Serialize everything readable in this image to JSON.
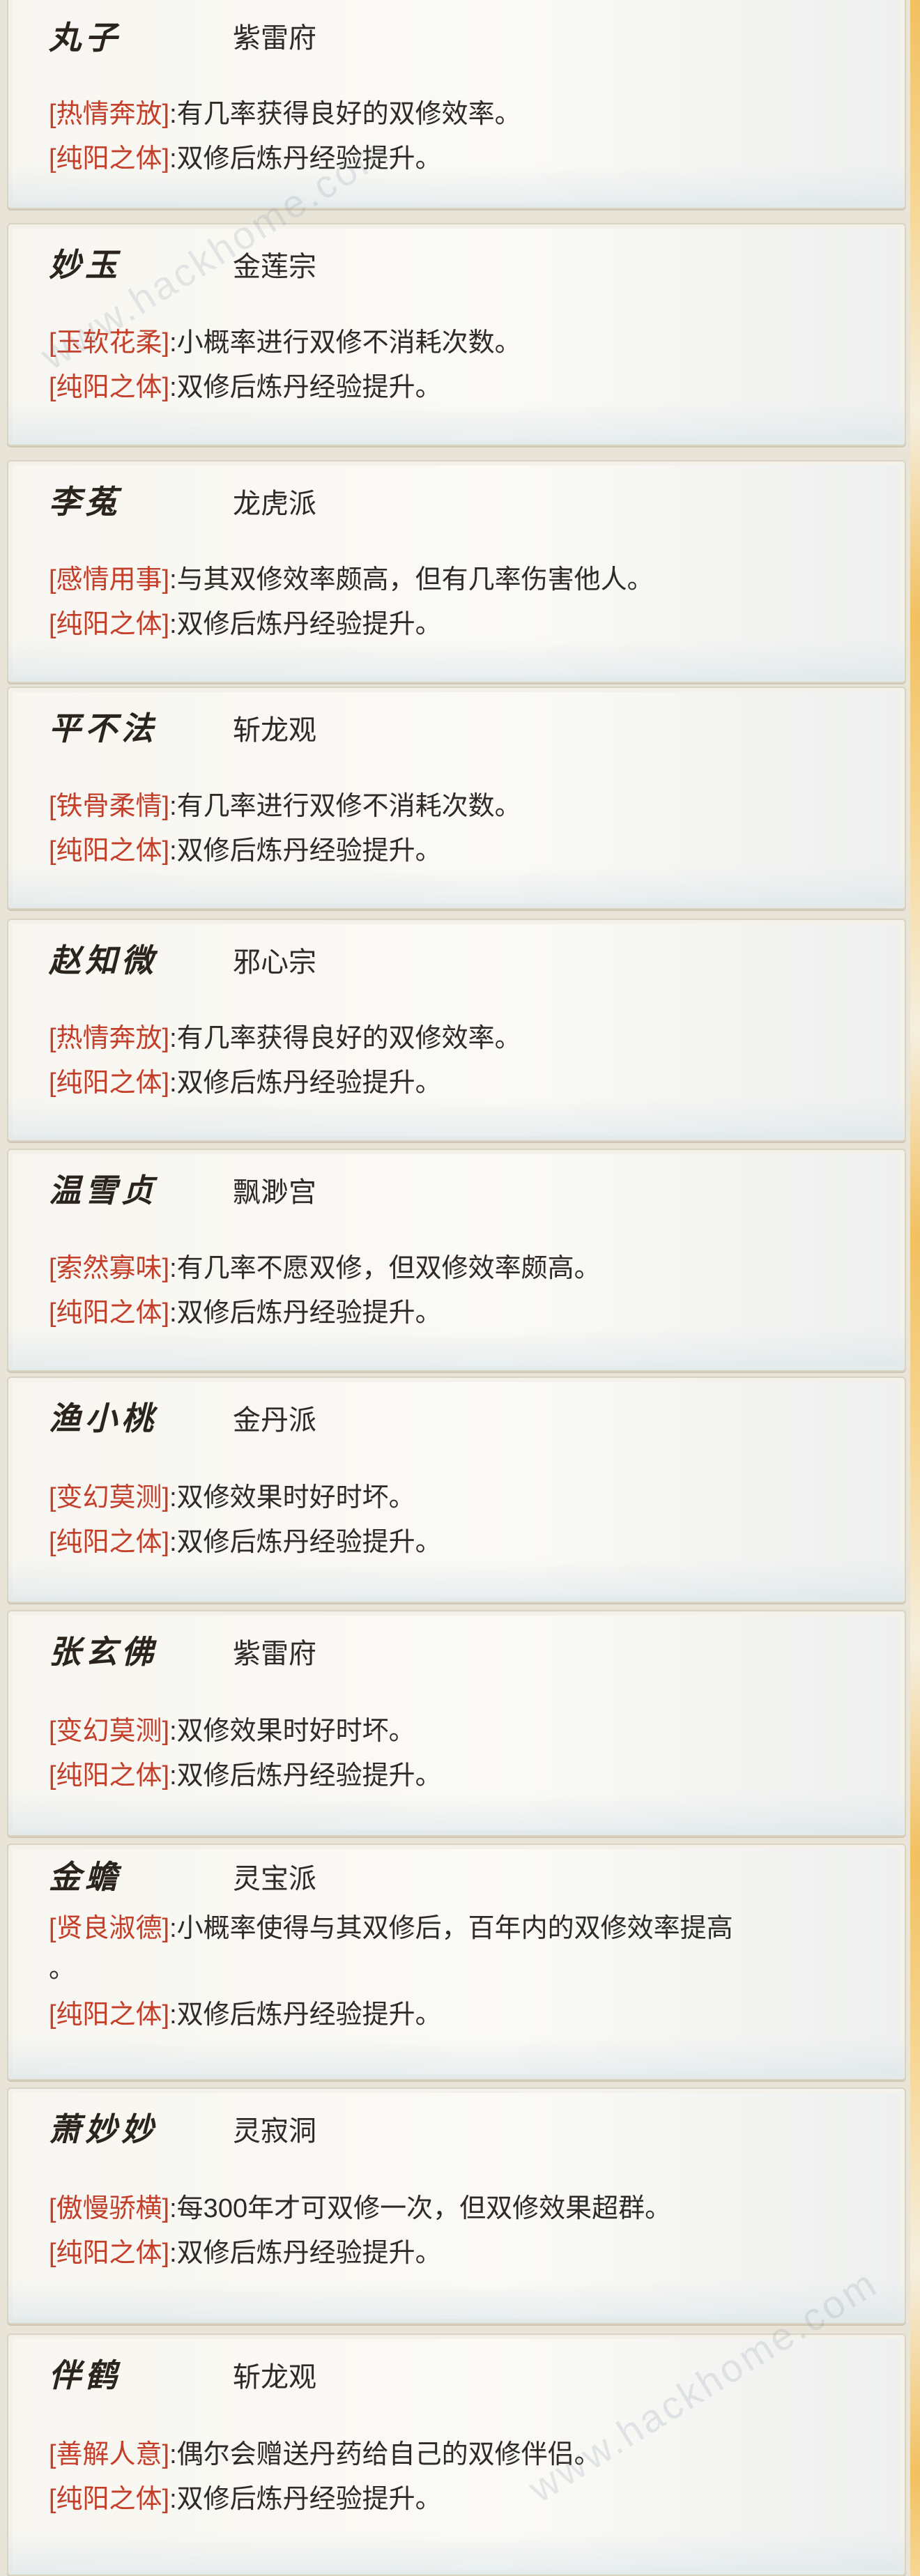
{
  "cards": [
    {
      "name": "丸子",
      "sect": "紫雷府",
      "traits": [
        {
          "tag": "[热情奔放]",
          "desc": ":有几率获得良好的双修效率。"
        },
        {
          "tag": "[纯阳之体]",
          "desc": ":双修后炼丹经验提升。"
        }
      ]
    },
    {
      "name": "妙玉",
      "sect": "金莲宗",
      "traits": [
        {
          "tag": "[玉软花柔]",
          "desc": ":小概率进行双修不消耗次数。"
        },
        {
          "tag": "[纯阳之体]",
          "desc": ":双修后炼丹经验提升。"
        }
      ]
    },
    {
      "name": "李菟",
      "sect": "龙虎派",
      "traits": [
        {
          "tag": "[感情用事]",
          "desc": ":与其双修效率颇高，但有几率伤害他人。"
        },
        {
          "tag": "[纯阳之体]",
          "desc": ":双修后炼丹经验提升。"
        }
      ]
    },
    {
      "name": "平不法",
      "sect": "斩龙观",
      "traits": [
        {
          "tag": "[铁骨柔情]",
          "desc": ":有几率进行双修不消耗次数。"
        },
        {
          "tag": "[纯阳之体]",
          "desc": ":双修后炼丹经验提升。"
        }
      ]
    },
    {
      "name": "赵知微",
      "sect": "邪心宗",
      "traits": [
        {
          "tag": "[热情奔放]",
          "desc": ":有几率获得良好的双修效率。"
        },
        {
          "tag": "[纯阳之体]",
          "desc": ":双修后炼丹经验提升。"
        }
      ]
    },
    {
      "name": "温雪贞",
      "sect": "飘渺宫",
      "traits": [
        {
          "tag": "[索然寡味]",
          "desc": ":有几率不愿双修，但双修效率颇高。"
        },
        {
          "tag": "[纯阳之体]",
          "desc": ":双修后炼丹经验提升。"
        }
      ]
    },
    {
      "name": "渔小桃",
      "sect": "金丹派",
      "traits": [
        {
          "tag": "[变幻莫测]",
          "desc": ":双修效果时好时坏。"
        },
        {
          "tag": "[纯阳之体]",
          "desc": ":双修后炼丹经验提升。"
        }
      ]
    },
    {
      "name": "张玄佛",
      "sect": "紫雷府",
      "traits": [
        {
          "tag": "[变幻莫测]",
          "desc": ":双修效果时好时坏。"
        },
        {
          "tag": "[纯阳之体]",
          "desc": ":双修后炼丹经验提升。"
        }
      ]
    },
    {
      "name": "金蟾",
      "sect": "灵宝派",
      "traits": [
        {
          "tag": "[贤良淑德]",
          "desc": ":小概率使得与其双修后，百年内的双修效率提高"
        },
        {
          "tag": "",
          "desc": "。"
        },
        {
          "tag": "[纯阳之体]",
          "desc": ":双修后炼丹经验提升。"
        }
      ]
    },
    {
      "name": "萧妙妙",
      "sect": "灵寂洞",
      "traits": [
        {
          "tag": "[傲慢骄横]",
          "desc": ":每300年才可双修一次，但双修效果超群。"
        },
        {
          "tag": "[纯阳之体]",
          "desc": ":双修后炼丹经验提升。"
        }
      ]
    },
    {
      "name": "伴鹤",
      "sect": "斩龙观",
      "traits": [
        {
          "tag": "[善解人意]",
          "desc": ":偶尔会赠送丹药给自己的双修伴侣。"
        },
        {
          "tag": "[纯阳之体]",
          "desc": ":双修后炼丹经验提升。"
        }
      ]
    }
  ],
  "watermarks": [
    "www.hackhome.com",
    "www.hackhome.com"
  ],
  "colors": {
    "tag": "#c43f2a",
    "text": "#2e2a26",
    "name": "#2b241c"
  }
}
